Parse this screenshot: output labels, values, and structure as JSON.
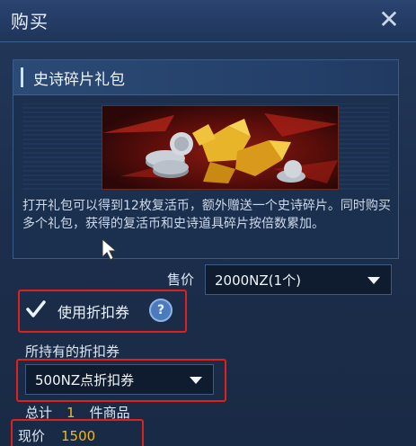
{
  "window": {
    "title": "购买",
    "close_icon": "close-icon"
  },
  "package": {
    "title": "史诗碎片礼包",
    "description": "打开礼包可以得到12枚复活币，额外赠送一个史诗碎片。同时购买多个礼包，获得的复活币和史诗道具碎片按倍数累加。"
  },
  "price": {
    "label": "售价",
    "selected": "2000NZ(1个)"
  },
  "coupon": {
    "checkbox_label": "使用折扣券",
    "checked": true,
    "help_icon": "?",
    "held_label": "所持有的折扣券",
    "selected": "500NZ点折扣券"
  },
  "total": {
    "label": "总计",
    "count": "1",
    "unit": "件商品"
  },
  "now_price": {
    "label": "现价",
    "value": "1500"
  },
  "colors": {
    "highlight": "#e0201a",
    "price_gold": "#f0b820",
    "accent_blue": "#4b7bbd"
  }
}
